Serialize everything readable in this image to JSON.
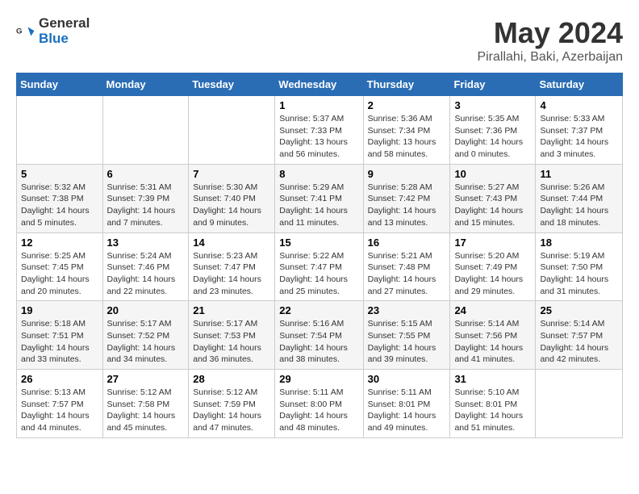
{
  "logo": {
    "text_general": "General",
    "text_blue": "Blue"
  },
  "title": "May 2024",
  "subtitle": "Pirallahi, Baki, Azerbaijan",
  "days_of_week": [
    "Sunday",
    "Monday",
    "Tuesday",
    "Wednesday",
    "Thursday",
    "Friday",
    "Saturday"
  ],
  "weeks": [
    [
      {
        "day": "",
        "info": ""
      },
      {
        "day": "",
        "info": ""
      },
      {
        "day": "",
        "info": ""
      },
      {
        "day": "1",
        "info": "Sunrise: 5:37 AM\nSunset: 7:33 PM\nDaylight: 13 hours\nand 56 minutes."
      },
      {
        "day": "2",
        "info": "Sunrise: 5:36 AM\nSunset: 7:34 PM\nDaylight: 13 hours\nand 58 minutes."
      },
      {
        "day": "3",
        "info": "Sunrise: 5:35 AM\nSunset: 7:36 PM\nDaylight: 14 hours\nand 0 minutes."
      },
      {
        "day": "4",
        "info": "Sunrise: 5:33 AM\nSunset: 7:37 PM\nDaylight: 14 hours\nand 3 minutes."
      }
    ],
    [
      {
        "day": "5",
        "info": "Sunrise: 5:32 AM\nSunset: 7:38 PM\nDaylight: 14 hours\nand 5 minutes."
      },
      {
        "day": "6",
        "info": "Sunrise: 5:31 AM\nSunset: 7:39 PM\nDaylight: 14 hours\nand 7 minutes."
      },
      {
        "day": "7",
        "info": "Sunrise: 5:30 AM\nSunset: 7:40 PM\nDaylight: 14 hours\nand 9 minutes."
      },
      {
        "day": "8",
        "info": "Sunrise: 5:29 AM\nSunset: 7:41 PM\nDaylight: 14 hours\nand 11 minutes."
      },
      {
        "day": "9",
        "info": "Sunrise: 5:28 AM\nSunset: 7:42 PM\nDaylight: 14 hours\nand 13 minutes."
      },
      {
        "day": "10",
        "info": "Sunrise: 5:27 AM\nSunset: 7:43 PM\nDaylight: 14 hours\nand 15 minutes."
      },
      {
        "day": "11",
        "info": "Sunrise: 5:26 AM\nSunset: 7:44 PM\nDaylight: 14 hours\nand 18 minutes."
      }
    ],
    [
      {
        "day": "12",
        "info": "Sunrise: 5:25 AM\nSunset: 7:45 PM\nDaylight: 14 hours\nand 20 minutes."
      },
      {
        "day": "13",
        "info": "Sunrise: 5:24 AM\nSunset: 7:46 PM\nDaylight: 14 hours\nand 22 minutes."
      },
      {
        "day": "14",
        "info": "Sunrise: 5:23 AM\nSunset: 7:47 PM\nDaylight: 14 hours\nand 23 minutes."
      },
      {
        "day": "15",
        "info": "Sunrise: 5:22 AM\nSunset: 7:47 PM\nDaylight: 14 hours\nand 25 minutes."
      },
      {
        "day": "16",
        "info": "Sunrise: 5:21 AM\nSunset: 7:48 PM\nDaylight: 14 hours\nand 27 minutes."
      },
      {
        "day": "17",
        "info": "Sunrise: 5:20 AM\nSunset: 7:49 PM\nDaylight: 14 hours\nand 29 minutes."
      },
      {
        "day": "18",
        "info": "Sunrise: 5:19 AM\nSunset: 7:50 PM\nDaylight: 14 hours\nand 31 minutes."
      }
    ],
    [
      {
        "day": "19",
        "info": "Sunrise: 5:18 AM\nSunset: 7:51 PM\nDaylight: 14 hours\nand 33 minutes."
      },
      {
        "day": "20",
        "info": "Sunrise: 5:17 AM\nSunset: 7:52 PM\nDaylight: 14 hours\nand 34 minutes."
      },
      {
        "day": "21",
        "info": "Sunrise: 5:17 AM\nSunset: 7:53 PM\nDaylight: 14 hours\nand 36 minutes."
      },
      {
        "day": "22",
        "info": "Sunrise: 5:16 AM\nSunset: 7:54 PM\nDaylight: 14 hours\nand 38 minutes."
      },
      {
        "day": "23",
        "info": "Sunrise: 5:15 AM\nSunset: 7:55 PM\nDaylight: 14 hours\nand 39 minutes."
      },
      {
        "day": "24",
        "info": "Sunrise: 5:14 AM\nSunset: 7:56 PM\nDaylight: 14 hours\nand 41 minutes."
      },
      {
        "day": "25",
        "info": "Sunrise: 5:14 AM\nSunset: 7:57 PM\nDaylight: 14 hours\nand 42 minutes."
      }
    ],
    [
      {
        "day": "26",
        "info": "Sunrise: 5:13 AM\nSunset: 7:57 PM\nDaylight: 14 hours\nand 44 minutes."
      },
      {
        "day": "27",
        "info": "Sunrise: 5:12 AM\nSunset: 7:58 PM\nDaylight: 14 hours\nand 45 minutes."
      },
      {
        "day": "28",
        "info": "Sunrise: 5:12 AM\nSunset: 7:59 PM\nDaylight: 14 hours\nand 47 minutes."
      },
      {
        "day": "29",
        "info": "Sunrise: 5:11 AM\nSunset: 8:00 PM\nDaylight: 14 hours\nand 48 minutes."
      },
      {
        "day": "30",
        "info": "Sunrise: 5:11 AM\nSunset: 8:01 PM\nDaylight: 14 hours\nand 49 minutes."
      },
      {
        "day": "31",
        "info": "Sunrise: 5:10 AM\nSunset: 8:01 PM\nDaylight: 14 hours\nand 51 minutes."
      },
      {
        "day": "",
        "info": ""
      }
    ]
  ]
}
